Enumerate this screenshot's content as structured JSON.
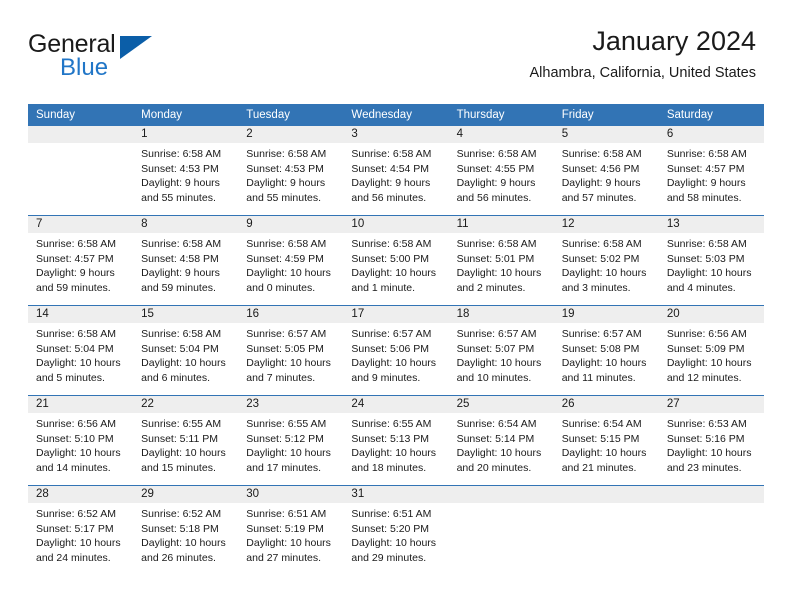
{
  "brand": {
    "name_part1": "General",
    "name_part2": "Blue"
  },
  "header": {
    "title": "January 2024",
    "subtitle": "Alhambra, California, United States"
  },
  "weekday_headers": [
    "Sunday",
    "Monday",
    "Tuesday",
    "Wednesday",
    "Thursday",
    "Friday",
    "Saturday"
  ],
  "colors": {
    "header_blue": "#3274b5",
    "brand_blue": "#2176c7",
    "triangle_blue": "#0b5ea8",
    "daynum_band": "#eeeeee"
  },
  "labels": {
    "sunrise_prefix": "Sunrise:",
    "sunset_prefix": "Sunset:",
    "daylight_prefix": "Daylight:"
  },
  "weeks": [
    [
      {
        "day": "",
        "empty": true
      },
      {
        "day": "1",
        "sunrise": "Sunrise: 6:58 AM",
        "sunset": "Sunset: 4:53 PM",
        "daylight_l1": "Daylight: 9 hours",
        "daylight_l2": "and 55 minutes."
      },
      {
        "day": "2",
        "sunrise": "Sunrise: 6:58 AM",
        "sunset": "Sunset: 4:53 PM",
        "daylight_l1": "Daylight: 9 hours",
        "daylight_l2": "and 55 minutes."
      },
      {
        "day": "3",
        "sunrise": "Sunrise: 6:58 AM",
        "sunset": "Sunset: 4:54 PM",
        "daylight_l1": "Daylight: 9 hours",
        "daylight_l2": "and 56 minutes."
      },
      {
        "day": "4",
        "sunrise": "Sunrise: 6:58 AM",
        "sunset": "Sunset: 4:55 PM",
        "daylight_l1": "Daylight: 9 hours",
        "daylight_l2": "and 56 minutes."
      },
      {
        "day": "5",
        "sunrise": "Sunrise: 6:58 AM",
        "sunset": "Sunset: 4:56 PM",
        "daylight_l1": "Daylight: 9 hours",
        "daylight_l2": "and 57 minutes."
      },
      {
        "day": "6",
        "sunrise": "Sunrise: 6:58 AM",
        "sunset": "Sunset: 4:57 PM",
        "daylight_l1": "Daylight: 9 hours",
        "daylight_l2": "and 58 minutes."
      }
    ],
    [
      {
        "day": "7",
        "sunrise": "Sunrise: 6:58 AM",
        "sunset": "Sunset: 4:57 PM",
        "daylight_l1": "Daylight: 9 hours",
        "daylight_l2": "and 59 minutes."
      },
      {
        "day": "8",
        "sunrise": "Sunrise: 6:58 AM",
        "sunset": "Sunset: 4:58 PM",
        "daylight_l1": "Daylight: 9 hours",
        "daylight_l2": "and 59 minutes."
      },
      {
        "day": "9",
        "sunrise": "Sunrise: 6:58 AM",
        "sunset": "Sunset: 4:59 PM",
        "daylight_l1": "Daylight: 10 hours",
        "daylight_l2": "and 0 minutes."
      },
      {
        "day": "10",
        "sunrise": "Sunrise: 6:58 AM",
        "sunset": "Sunset: 5:00 PM",
        "daylight_l1": "Daylight: 10 hours",
        "daylight_l2": "and 1 minute."
      },
      {
        "day": "11",
        "sunrise": "Sunrise: 6:58 AM",
        "sunset": "Sunset: 5:01 PM",
        "daylight_l1": "Daylight: 10 hours",
        "daylight_l2": "and 2 minutes."
      },
      {
        "day": "12",
        "sunrise": "Sunrise: 6:58 AM",
        "sunset": "Sunset: 5:02 PM",
        "daylight_l1": "Daylight: 10 hours",
        "daylight_l2": "and 3 minutes."
      },
      {
        "day": "13",
        "sunrise": "Sunrise: 6:58 AM",
        "sunset": "Sunset: 5:03 PM",
        "daylight_l1": "Daylight: 10 hours",
        "daylight_l2": "and 4 minutes."
      }
    ],
    [
      {
        "day": "14",
        "sunrise": "Sunrise: 6:58 AM",
        "sunset": "Sunset: 5:04 PM",
        "daylight_l1": "Daylight: 10 hours",
        "daylight_l2": "and 5 minutes."
      },
      {
        "day": "15",
        "sunrise": "Sunrise: 6:58 AM",
        "sunset": "Sunset: 5:04 PM",
        "daylight_l1": "Daylight: 10 hours",
        "daylight_l2": "and 6 minutes."
      },
      {
        "day": "16",
        "sunrise": "Sunrise: 6:57 AM",
        "sunset": "Sunset: 5:05 PM",
        "daylight_l1": "Daylight: 10 hours",
        "daylight_l2": "and 7 minutes."
      },
      {
        "day": "17",
        "sunrise": "Sunrise: 6:57 AM",
        "sunset": "Sunset: 5:06 PM",
        "daylight_l1": "Daylight: 10 hours",
        "daylight_l2": "and 9 minutes."
      },
      {
        "day": "18",
        "sunrise": "Sunrise: 6:57 AM",
        "sunset": "Sunset: 5:07 PM",
        "daylight_l1": "Daylight: 10 hours",
        "daylight_l2": "and 10 minutes."
      },
      {
        "day": "19",
        "sunrise": "Sunrise: 6:57 AM",
        "sunset": "Sunset: 5:08 PM",
        "daylight_l1": "Daylight: 10 hours",
        "daylight_l2": "and 11 minutes."
      },
      {
        "day": "20",
        "sunrise": "Sunrise: 6:56 AM",
        "sunset": "Sunset: 5:09 PM",
        "daylight_l1": "Daylight: 10 hours",
        "daylight_l2": "and 12 minutes."
      }
    ],
    [
      {
        "day": "21",
        "sunrise": "Sunrise: 6:56 AM",
        "sunset": "Sunset: 5:10 PM",
        "daylight_l1": "Daylight: 10 hours",
        "daylight_l2": "and 14 minutes."
      },
      {
        "day": "22",
        "sunrise": "Sunrise: 6:55 AM",
        "sunset": "Sunset: 5:11 PM",
        "daylight_l1": "Daylight: 10 hours",
        "daylight_l2": "and 15 minutes."
      },
      {
        "day": "23",
        "sunrise": "Sunrise: 6:55 AM",
        "sunset": "Sunset: 5:12 PM",
        "daylight_l1": "Daylight: 10 hours",
        "daylight_l2": "and 17 minutes."
      },
      {
        "day": "24",
        "sunrise": "Sunrise: 6:55 AM",
        "sunset": "Sunset: 5:13 PM",
        "daylight_l1": "Daylight: 10 hours",
        "daylight_l2": "and 18 minutes."
      },
      {
        "day": "25",
        "sunrise": "Sunrise: 6:54 AM",
        "sunset": "Sunset: 5:14 PM",
        "daylight_l1": "Daylight: 10 hours",
        "daylight_l2": "and 20 minutes."
      },
      {
        "day": "26",
        "sunrise": "Sunrise: 6:54 AM",
        "sunset": "Sunset: 5:15 PM",
        "daylight_l1": "Daylight: 10 hours",
        "daylight_l2": "and 21 minutes."
      },
      {
        "day": "27",
        "sunrise": "Sunrise: 6:53 AM",
        "sunset": "Sunset: 5:16 PM",
        "daylight_l1": "Daylight: 10 hours",
        "daylight_l2": "and 23 minutes."
      }
    ],
    [
      {
        "day": "28",
        "sunrise": "Sunrise: 6:52 AM",
        "sunset": "Sunset: 5:17 PM",
        "daylight_l1": "Daylight: 10 hours",
        "daylight_l2": "and 24 minutes."
      },
      {
        "day": "29",
        "sunrise": "Sunrise: 6:52 AM",
        "sunset": "Sunset: 5:18 PM",
        "daylight_l1": "Daylight: 10 hours",
        "daylight_l2": "and 26 minutes."
      },
      {
        "day": "30",
        "sunrise": "Sunrise: 6:51 AM",
        "sunset": "Sunset: 5:19 PM",
        "daylight_l1": "Daylight: 10 hours",
        "daylight_l2": "and 27 minutes."
      },
      {
        "day": "31",
        "sunrise": "Sunrise: 6:51 AM",
        "sunset": "Sunset: 5:20 PM",
        "daylight_l1": "Daylight: 10 hours",
        "daylight_l2": "and 29 minutes."
      },
      {
        "day": "",
        "empty": true
      },
      {
        "day": "",
        "empty": true
      },
      {
        "day": "",
        "empty": true
      }
    ]
  ]
}
